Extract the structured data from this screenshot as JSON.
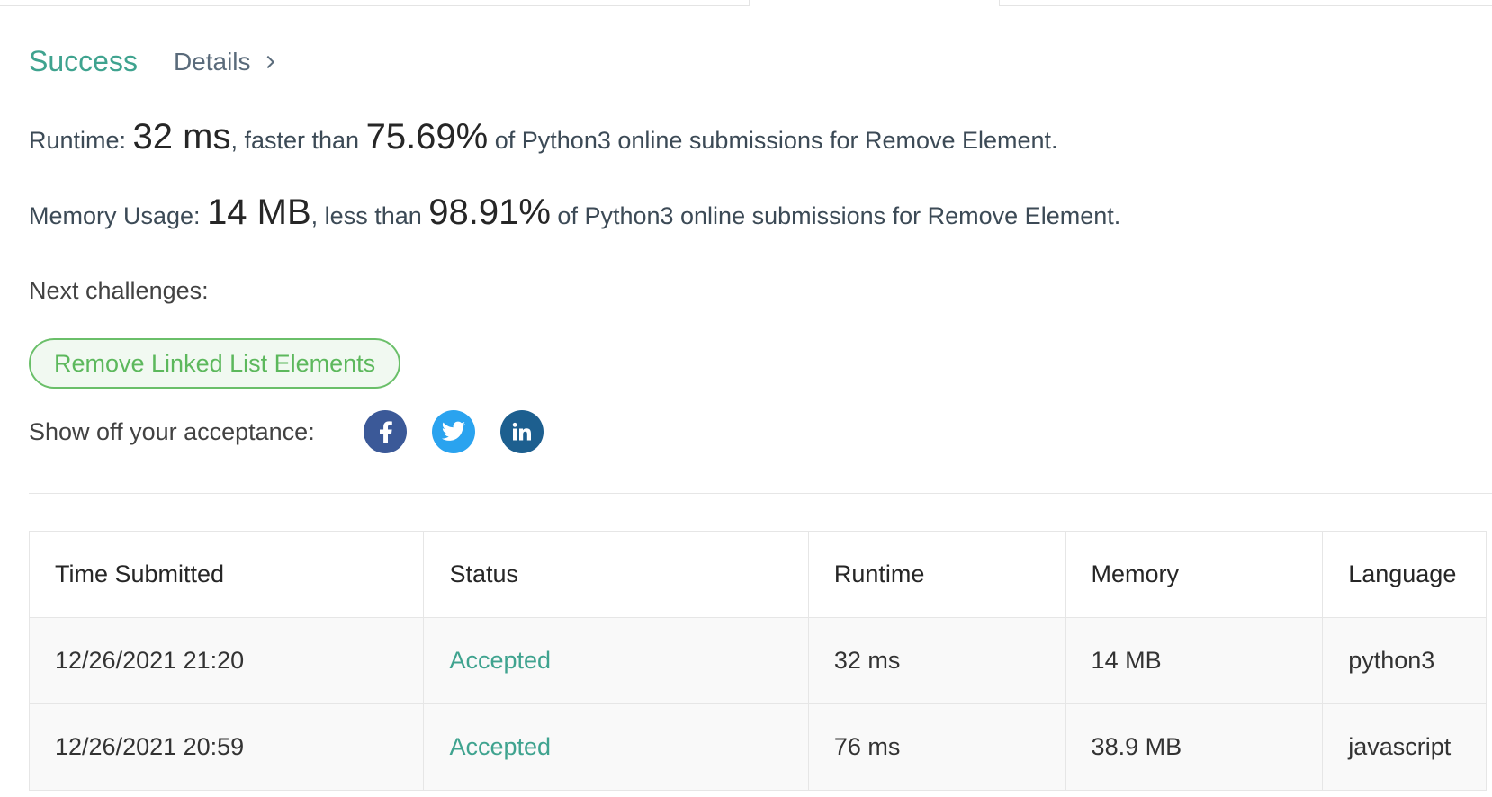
{
  "result": {
    "status": "Success",
    "details_label": "Details"
  },
  "runtime": {
    "label": "Runtime: ",
    "value": "32 ms",
    "middle": ", faster than ",
    "percent": "75.69%",
    "suffix": " of Python3 online submissions for Remove Element."
  },
  "memory": {
    "label": "Memory Usage: ",
    "value": "14 MB",
    "middle": ", less than ",
    "percent": "98.91%",
    "suffix": " of Python3 online submissions for Remove Element."
  },
  "next": {
    "label": "Next challenges:",
    "challenge": "Remove Linked List Elements"
  },
  "share": {
    "label": "Show off your acceptance:",
    "icons": [
      "facebook-icon",
      "twitter-icon",
      "linkedin-icon"
    ],
    "colors": {
      "facebook": "#3b5998",
      "twitter": "#2aa3ef",
      "linkedin": "#1d5f8f"
    }
  },
  "table": {
    "headers": [
      "Time Submitted",
      "Status",
      "Runtime",
      "Memory",
      "Language"
    ],
    "rows": [
      [
        "12/26/2021 21:20",
        "Accepted",
        "32 ms",
        "14 MB",
        "python3"
      ],
      [
        "12/26/2021 20:59",
        "Accepted",
        "76 ms",
        "38.9 MB",
        "javascript"
      ]
    ]
  },
  "colors": {
    "success": "#3fa38f",
    "challenge_border": "#6abf69"
  }
}
